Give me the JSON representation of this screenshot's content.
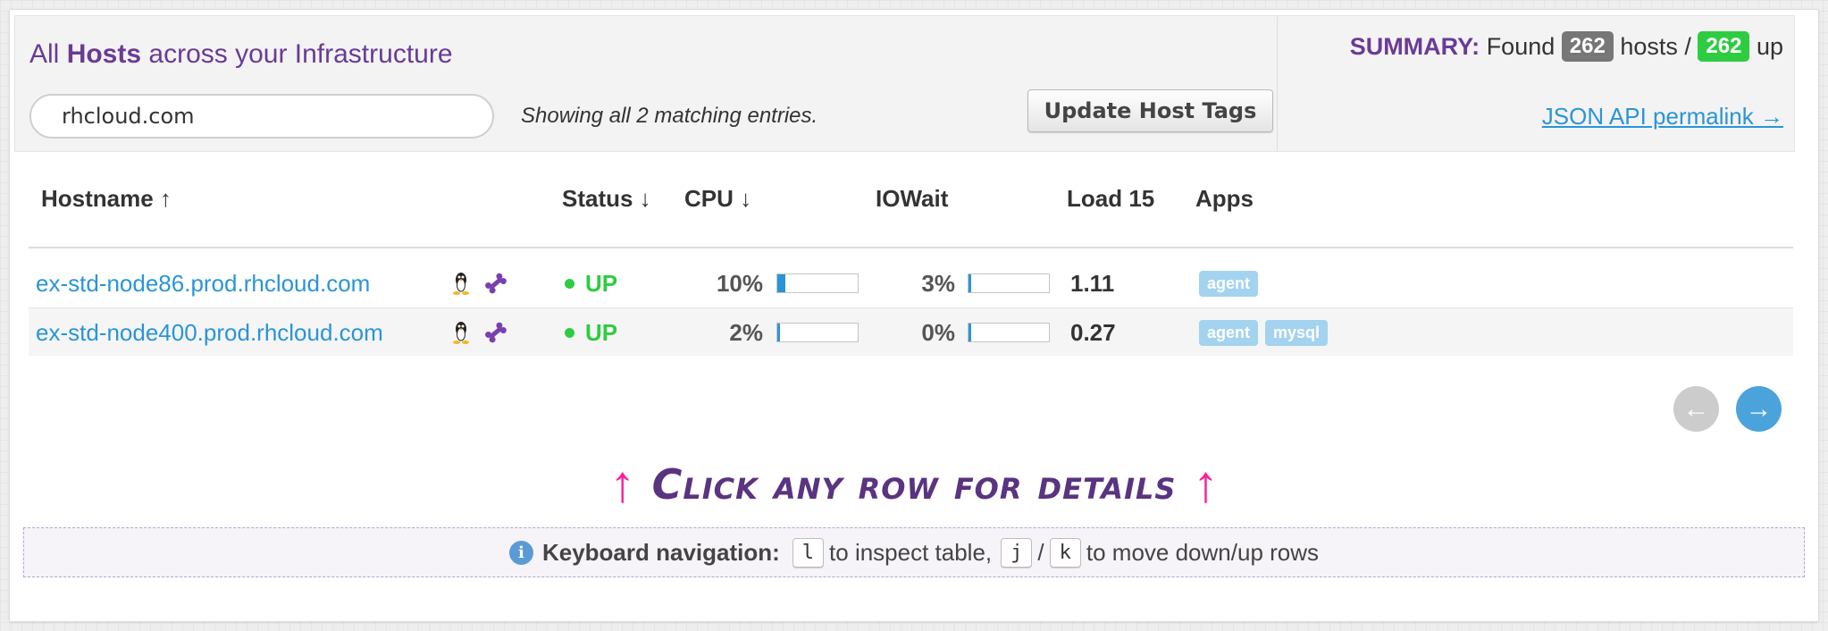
{
  "header": {
    "title_prefix": "All",
    "title_bold": "Hosts",
    "title_suffix": "across your Infrastructure",
    "search_value": "rhcloud.com",
    "matching_text": "Showing all 2 matching entries.",
    "update_button": "Update Host Tags"
  },
  "summary": {
    "label": "SUMMARY:",
    "found": "Found",
    "hosts_count": "262",
    "hosts_label": "hosts /",
    "up_count": "262",
    "up_label": "up",
    "json_link": "JSON API permalink →"
  },
  "columns": {
    "hostname": "Hostname ↑",
    "status": "Status ↓",
    "cpu": "CPU ↓",
    "iowait": "IOWait",
    "load": "Load 15",
    "apps": "Apps"
  },
  "rows": [
    {
      "hostname": "ex-std-node86.prod.rhcloud.com",
      "status": "UP",
      "cpu": "10%",
      "cpu_fraction": 0.1,
      "iowait": "3%",
      "iowait_fraction": 0.03,
      "load": "1.11",
      "apps": [
        "agent"
      ]
    },
    {
      "hostname": "ex-std-node400.prod.rhcloud.com",
      "status": "UP",
      "cpu": "2%",
      "cpu_fraction": 0.02,
      "iowait": "0%",
      "iowait_fraction": 0.0,
      "load": "0.27",
      "apps": [
        "agent",
        "mysql"
      ]
    }
  ],
  "pagination": {
    "prev": "←",
    "next": "→"
  },
  "hint": {
    "arrow": "↑",
    "text": "Click any row for details"
  },
  "keyboard": {
    "icon": "i",
    "title": "Keyboard navigation:",
    "key_inspect": "l",
    "inspect_text": "to inspect table,",
    "key_down": "j",
    "slash": "/",
    "key_up": "k",
    "move_text": "to move down/up rows"
  },
  "icons": {
    "os": "linux-tux-icon",
    "tag": "bone-icon"
  },
  "colors": {
    "brand": "#6a3b94",
    "link": "#2a95d6",
    "up": "#2ecc40",
    "hint_arrow": "#ff1f9a",
    "app_badge": "#a3d3ee"
  }
}
